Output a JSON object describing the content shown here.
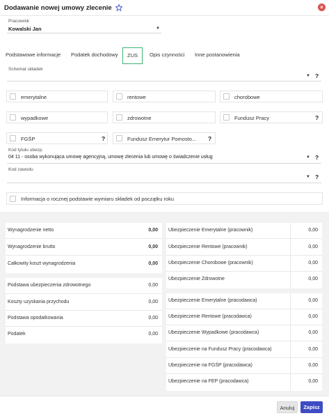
{
  "window": {
    "title": "Dodawanie nowej umowy zlecenie"
  },
  "employee": {
    "label": "Pracownik",
    "value": "Kowalski Jan"
  },
  "tabs": [
    {
      "label": "Podstawowe informacje"
    },
    {
      "label": "Podatek dochodowy"
    },
    {
      "label": "ZUS"
    },
    {
      "label": "Opis czynności"
    },
    {
      "label": "Inne postanowienia"
    }
  ],
  "active_tab": "ZUS",
  "schema": {
    "label": "Schemat składek",
    "value": "",
    "help": "?"
  },
  "contributions": {
    "emerytalne": "emerytalne",
    "rentowe": "rentowe",
    "chorobowe": "chorobowe",
    "wypadkowe": "wypadkowe",
    "zdrowotne": "zdrowotne",
    "fundusz_pracy": "Fundusz Pracy",
    "fgsp": "FGŚP",
    "fep": "Fundusz Emerytur Pomosto...",
    "help": "?"
  },
  "title_code": {
    "label": "Kod tytułu ubezp.",
    "value": "04 11 - osoba wykonująca umowę agencyjną, umowę zlecenia lub umowę o świadczenie usług",
    "help": "?"
  },
  "occupation_code": {
    "label": "Kod zawodu",
    "value": "",
    "help": "?"
  },
  "annual_info": {
    "label": "Informacja o rocznej podstawie wymiaru składek od początku roku"
  },
  "summary_left_top": [
    {
      "label": "Wynagrodzenie netto",
      "value": "0,00"
    },
    {
      "label": "Wynagrodzenie brutto",
      "value": "0,00"
    },
    {
      "label": "Całkowity koszt wynagrodzenia",
      "value": "0,00"
    }
  ],
  "summary_left_bottom": [
    {
      "label": "Podstawa ubezpieczenia zdrowotnego",
      "value": "0,00"
    },
    {
      "label": "Koszty uzyskania przychodu",
      "value": "0,00"
    },
    {
      "label": "Podstawa opodatkowania",
      "value": "0,00"
    },
    {
      "label": "Podatek",
      "value": "0,00"
    }
  ],
  "summary_right_top": [
    {
      "label": "Ubezpieczenie Emerytalne (pracownik)",
      "value": "0,00"
    },
    {
      "label": "Ubezpieczenie Rentowe (pracownik)",
      "value": "0,00"
    },
    {
      "label": "Ubezpieczenie Chorobowe (pracownik)",
      "value": "0,00"
    },
    {
      "label": "Ubezpieczenie Zdrowotne",
      "value": "0,00"
    }
  ],
  "summary_right_bottom": [
    {
      "label": "Ubezpieczenie Emerytalne (pracodawca)",
      "value": "0,00"
    },
    {
      "label": "Ubezpieczenie Rentowe (pracodawca)",
      "value": "0,00"
    },
    {
      "label": "Ubezpieczenie Wypadkowe (pracodawca)",
      "value": "0,00"
    },
    {
      "label": "Ubezpieczenie na Fundusz Pracy (pracodawca)",
      "value": "0,00"
    },
    {
      "label": "Ubezpieczenie na FGŚP (pracodawca)",
      "value": "0,00"
    },
    {
      "label": "Ubezpieczenie na FEP (pracodawca)",
      "value": "0,00"
    }
  ],
  "buttons": {
    "cancel": "Anuluj",
    "save": "Zapisz"
  },
  "colors": {
    "accent": "#3e4cc4",
    "active_tab_border": "#3cb371",
    "close": "#d9534f"
  }
}
